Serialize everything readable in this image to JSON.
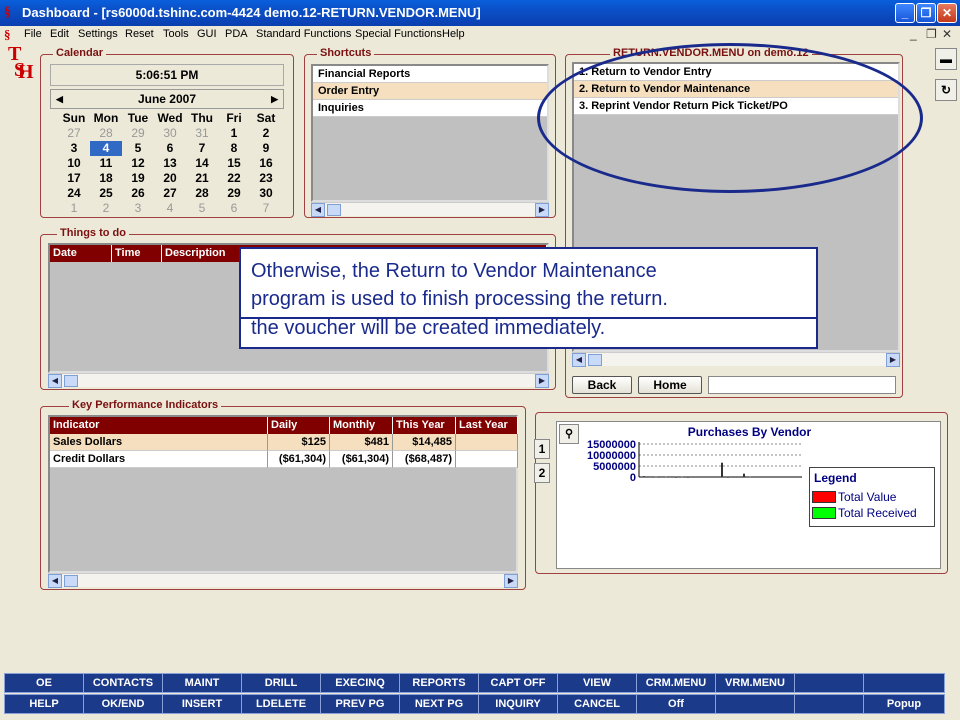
{
  "window": {
    "title": "Dashboard - [rs6000d.tshinc.com-4424 demo.12-RETURN.VENDOR.MENU]",
    "icon_text": "TSH"
  },
  "menubar": {
    "items": [
      "File",
      "Edit",
      "Settings",
      "Reset",
      "Tools",
      "GUI",
      "PDA",
      "Standard Functions",
      "Special Functions",
      "Help"
    ]
  },
  "calendar": {
    "title": "Calendar",
    "time": "5:06:51 PM",
    "month_label": "June 2007",
    "days_of_week": [
      "Sun",
      "Mon",
      "Tue",
      "Wed",
      "Thu",
      "Fri",
      "Sat"
    ],
    "weeks": [
      [
        "27",
        "28",
        "29",
        "30",
        "31",
        "1",
        "2"
      ],
      [
        "3",
        "4",
        "5",
        "6",
        "7",
        "8",
        "9"
      ],
      [
        "10",
        "11",
        "12",
        "13",
        "14",
        "15",
        "16"
      ],
      [
        "17",
        "18",
        "19",
        "20",
        "21",
        "22",
        "23"
      ],
      [
        "24",
        "25",
        "26",
        "27",
        "28",
        "29",
        "30"
      ],
      [
        "1",
        "2",
        "3",
        "4",
        "5",
        "6",
        "7"
      ]
    ],
    "selected_day": "4"
  },
  "shortcuts": {
    "title": "Shortcuts",
    "items": [
      "Financial Reports",
      "Order Entry",
      "Inquiries"
    ]
  },
  "vendor_menu": {
    "title": "RETURN.VENDOR.MENU on demo.12",
    "items": [
      "1. Return to Vendor Entry",
      "2. Return to Vendor Maintenance",
      "3. Reprint Vendor Return Pick Ticket/PO"
    ],
    "back_label": "Back",
    "home_label": "Home",
    "command_value": ""
  },
  "things_to_do": {
    "title": "Things to do",
    "columns": [
      "Date",
      "Time",
      "Description"
    ]
  },
  "callout": {
    "line1": "Otherwise, the Return to Vendor Maintenance",
    "line1b": "program is used to finish processing the return.",
    "line2": "the voucher will be created immediately."
  },
  "kpi": {
    "title": "Key Performance Indicators",
    "columns": [
      "Indicator",
      "Daily",
      "Monthly",
      "This Year",
      "Last Year"
    ],
    "rows": [
      [
        "Sales Dollars",
        "$125",
        "$481",
        "$14,485",
        ""
      ],
      [
        "Credit Dollars",
        "($61,304)",
        "($61,304)",
        "($68,487)",
        ""
      ]
    ]
  },
  "chart_tabs": [
    "1",
    "2"
  ],
  "chart_data": {
    "type": "bar",
    "title": "Purchases By Vendor",
    "y_ticks": [
      "15000000",
      "10000000",
      "5000000",
      "0"
    ],
    "ylim": [
      0,
      15000000
    ],
    "legend_title": "Legend",
    "series": [
      {
        "name": "Total Value",
        "color": "#ff0000",
        "values": [
          400000,
          300000,
          200000,
          300000,
          200000,
          300000,
          100000,
          200000,
          100000,
          6500000,
          100000,
          1500000,
          200000
        ]
      },
      {
        "name": "Total Received",
        "color": "#00ff00",
        "values": [
          0,
          0,
          0,
          0,
          0,
          0,
          0,
          0,
          0,
          0,
          0,
          0,
          0
        ]
      }
    ],
    "grid": true,
    "legend_position": "right"
  },
  "function_keys": {
    "row1": [
      "OE",
      "CONTACTS",
      "MAINT",
      "DRILL",
      "EXECINQ",
      "REPORTS",
      "CAPT OFF",
      "VIEW",
      "CRM.MENU",
      "VRM.MENU",
      "",
      ""
    ],
    "row2": [
      "HELP",
      "OK/END",
      "INSERT",
      "LDELETE",
      "PREV PG",
      "NEXT PG",
      "INQUIRY",
      "CANCEL",
      "Off",
      "",
      "",
      "Popup"
    ]
  }
}
